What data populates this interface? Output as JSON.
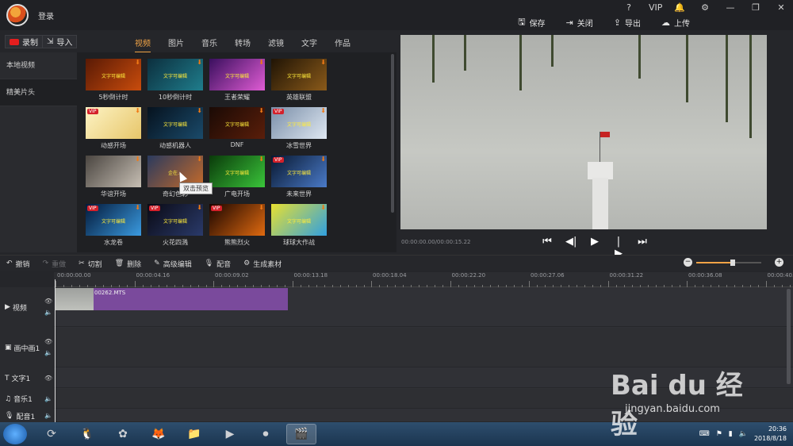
{
  "app": {
    "login": "登录",
    "top_buttons": [
      {
        "label": "保存",
        "icon": "save-icon",
        "glyph": "🖫"
      },
      {
        "label": "关闭",
        "icon": "close-file-icon",
        "glyph": "⇥"
      },
      {
        "label": "导出",
        "icon": "export-icon",
        "glyph": "⇪"
      },
      {
        "label": "上传",
        "icon": "upload-icon",
        "glyph": "☁"
      }
    ],
    "sys_icons": [
      "?",
      "VIP",
      "🔔",
      "⚙",
      "—",
      "❐",
      "✕"
    ]
  },
  "toolbar": {
    "record_label": "录制",
    "import_label": "导入",
    "tabs": [
      "视频",
      "图片",
      "音乐",
      "转场",
      "滤镜",
      "文字",
      "作品"
    ],
    "active_tab": 0
  },
  "leftnav": {
    "items": [
      "本地视频",
      "精美片头"
    ],
    "active": 1
  },
  "templates": [
    {
      "label": "5秒倒计时",
      "vip": false,
      "colors": [
        "#5a1a05",
        "#c94c0c"
      ],
      "overlay": "文字可编辑"
    },
    {
      "label": "10秒倒计时",
      "vip": false,
      "colors": [
        "#0c2f3e",
        "#1f7d8c"
      ],
      "overlay": "文字可编辑"
    },
    {
      "label": "王者荣耀",
      "vip": false,
      "colors": [
        "#3a0f5e",
        "#e05cd4"
      ],
      "overlay": "文字可编辑"
    },
    {
      "label": "英雄联盟",
      "vip": false,
      "colors": [
        "#201405",
        "#8a5a1a"
      ],
      "overlay": "文字可编辑"
    },
    {
      "label": "动感开场",
      "vip": true,
      "colors": [
        "#fdf3c4",
        "#e7c66a"
      ],
      "overlay": ""
    },
    {
      "label": "动感机器人",
      "vip": false,
      "colors": [
        "#06121e",
        "#1a4a6a"
      ],
      "overlay": "文字可编辑"
    },
    {
      "label": "DNF",
      "vip": false,
      "colors": [
        "#1a0a05",
        "#5a1e0a"
      ],
      "overlay": "文字可编辑"
    },
    {
      "label": "冰雪世界",
      "vip": true,
      "colors": [
        "#7a8ea8",
        "#dfe8f2"
      ],
      "overlay": "文字可编辑"
    },
    {
      "label": "华谊开场",
      "vip": false,
      "colors": [
        "#4a4540",
        "#c7bfb4"
      ],
      "overlay": ""
    },
    {
      "label": "奇幻色彩",
      "vip": false,
      "colors": [
        "#2a3a5e",
        "#c46a2a"
      ],
      "overlay": "企在…"
    },
    {
      "label": "广电开场",
      "vip": false,
      "colors": [
        "#0a3a0a",
        "#3ac43a"
      ],
      "overlay": "文字可编辑"
    },
    {
      "label": "未来世界",
      "vip": true,
      "colors": [
        "#081830",
        "#4a7ac8"
      ],
      "overlay": "文字可编辑"
    },
    {
      "label": "水龙卷",
      "vip": true,
      "colors": [
        "#041a3a",
        "#3a9ae0"
      ],
      "overlay": "文字可编辑"
    },
    {
      "label": "火花四溅",
      "vip": true,
      "colors": [
        "#0a0a14",
        "#2a3a6a"
      ],
      "overlay": "文字可编辑"
    },
    {
      "label": "熊熊烈火",
      "vip": true,
      "colors": [
        "#1a0500",
        "#e06a10"
      ],
      "overlay": ""
    },
    {
      "label": "球球大作战",
      "vip": false,
      "colors": [
        "#e8e030",
        "#30a0e0"
      ],
      "overlay": "文字可编辑"
    }
  ],
  "tooltip": "双击预览",
  "preview": {
    "timecode": "00:00:00.00/00:00:15.22"
  },
  "edit_tools": [
    {
      "label": "撤销",
      "glyph": "↶",
      "icon": "undo-icon",
      "enabled": true
    },
    {
      "label": "重做",
      "glyph": "↷",
      "icon": "redo-icon",
      "enabled": false
    },
    {
      "label": "切割",
      "glyph": "✂",
      "icon": "cut-icon",
      "enabled": true
    },
    {
      "label": "删除",
      "glyph": "🗑",
      "icon": "delete-icon",
      "enabled": true
    },
    {
      "label": "高级编辑",
      "glyph": "✎",
      "icon": "edit-icon",
      "enabled": true
    },
    {
      "label": "配音",
      "glyph": "🎙",
      "icon": "mic-icon",
      "enabled": true
    },
    {
      "label": "生成素材",
      "glyph": "⚙",
      "icon": "generate-icon",
      "enabled": true
    }
  ],
  "zoom": {
    "level": 0.56
  },
  "ruler": [
    "00:00:00.00",
    "00:00:04.16",
    "00:00:09.02",
    "00:00:13.18",
    "00:00:18.04",
    "00:00:22.20",
    "00:00:27.06",
    "00:00:31.22",
    "00:00:36.08",
    "00:00:40."
  ],
  "tracks": [
    {
      "label": "视频",
      "glyph": "▶",
      "icon": "video-track-icon",
      "side": [
        "👁",
        "🔈"
      ]
    },
    {
      "label": "画中画1",
      "glyph": "▣",
      "icon": "pip-track-icon",
      "side": [
        "👁",
        "🔈"
      ]
    },
    {
      "label": "文字1",
      "glyph": "T",
      "icon": "text-track-icon",
      "side": [
        "👁"
      ]
    },
    {
      "label": "音乐1",
      "glyph": "♫",
      "icon": "music-track-icon",
      "side": [
        "🔈"
      ]
    },
    {
      "label": "配音1",
      "glyph": "🎙",
      "icon": "voice-track-icon",
      "side": [
        "🔈"
      ]
    }
  ],
  "clip": {
    "name": "00262.MTS"
  },
  "taskbar": {
    "apps": [
      {
        "glyph": "⟳",
        "icon": "app-360-icon",
        "active": false
      },
      {
        "glyph": "🐧",
        "icon": "qq-icon",
        "active": false
      },
      {
        "glyph": "✿",
        "icon": "media-player-icon",
        "active": false
      },
      {
        "glyph": "🦊",
        "icon": "firefox-icon",
        "active": false
      },
      {
        "glyph": "📁",
        "icon": "folder-icon",
        "active": false
      },
      {
        "glyph": "▶",
        "icon": "video-app-icon",
        "active": false
      },
      {
        "glyph": "⏺",
        "icon": "recorder-icon",
        "active": false
      },
      {
        "glyph": "🎬",
        "icon": "editor-app-icon",
        "active": true
      }
    ],
    "time": "20:36",
    "date": "2018/8/18"
  },
  "watermark": {
    "brand": "Bai du 经验",
    "site": "jingyan.baidu.com"
  }
}
